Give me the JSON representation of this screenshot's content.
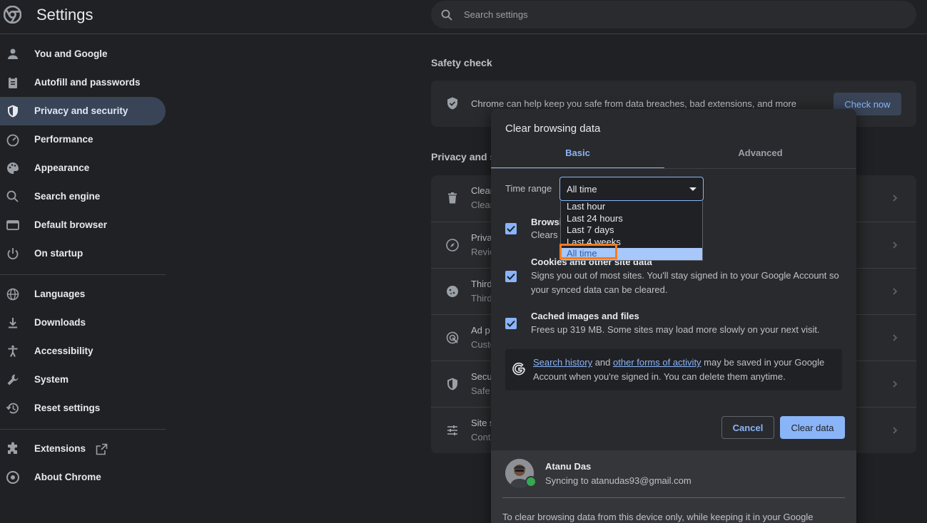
{
  "header": {
    "title": "Settings",
    "search_placeholder": "Search settings"
  },
  "sidebar": {
    "items": [
      {
        "label": "You and Google",
        "icon": "person-icon"
      },
      {
        "label": "Autofill and passwords",
        "icon": "clipboard-icon"
      },
      {
        "label": "Privacy and security",
        "icon": "shield-icon",
        "active": true
      },
      {
        "label": "Performance",
        "icon": "gauge-icon"
      },
      {
        "label": "Appearance",
        "icon": "palette-icon"
      },
      {
        "label": "Search engine",
        "icon": "search-icon"
      },
      {
        "label": "Default browser",
        "icon": "browser-icon"
      },
      {
        "label": "On startup",
        "icon": "power-icon"
      },
      {
        "label": "Languages",
        "icon": "globe-icon"
      },
      {
        "label": "Downloads",
        "icon": "download-icon"
      },
      {
        "label": "Accessibility",
        "icon": "accessibility-icon"
      },
      {
        "label": "System",
        "icon": "wrench-icon"
      },
      {
        "label": "Reset settings",
        "icon": "history-icon"
      },
      {
        "label": "Extensions",
        "icon": "puzzle-icon"
      },
      {
        "label": "About Chrome",
        "icon": "chrome-icon"
      }
    ]
  },
  "main": {
    "safety_check": {
      "title": "Safety check",
      "text": "Chrome can help keep you safe from data breaches, bad extensions, and more",
      "button": "Check now"
    },
    "privacy_title": "Privacy and s",
    "privacy_rows": [
      {
        "title": "Clear",
        "desc": "Clear",
        "icon": "trash-icon"
      },
      {
        "title": "Priva",
        "desc": "Revie",
        "icon": "compass-icon"
      },
      {
        "title": "Third",
        "desc": "Third",
        "icon": "cookie-icon"
      },
      {
        "title": "Ad p",
        "desc": "Custo",
        "icon": "ad-privacy-icon"
      },
      {
        "title": "Secu",
        "desc": "Safe",
        "icon": "shield-icon"
      },
      {
        "title": "Site s",
        "desc": "Cont",
        "icon": "sliders-icon"
      }
    ]
  },
  "dialog": {
    "title": "Clear browsing data",
    "tabs": {
      "basic": "Basic",
      "advanced": "Advanced"
    },
    "time_range": {
      "label": "Time range",
      "value": "All time",
      "options": [
        "Last hour",
        "Last 24 hours",
        "Last 7 days",
        "Last 4 weeks",
        "All time"
      ]
    },
    "items": [
      {
        "title": "Browsi",
        "desc": "Clears"
      },
      {
        "title": "Cookies and other site data",
        "desc": "Signs you out of most sites. You'll stay signed in to your Google Account so your synced data can be cleared."
      },
      {
        "title": "Cached images and files",
        "desc": "Frees up 319 MB. Some sites may load more slowly on your next visit."
      }
    ],
    "google_notice": {
      "link1": "Search history",
      "mid": " and ",
      "link2": "other forms of activity",
      "rest": " may be saved in your Google Account when you're signed in. You can delete them anytime."
    },
    "cancel": "Cancel",
    "clear": "Clear data",
    "account": {
      "name": "Atanu Das",
      "sync": "Syncing to atanudas93@gmail.com"
    },
    "footer_note": "To clear browsing data from this device only, while keeping it in your Google"
  },
  "colors": {
    "accent": "#8ab4f8",
    "active_nav": "#394457",
    "highlight": "#f57c1f",
    "background": "#202124"
  }
}
